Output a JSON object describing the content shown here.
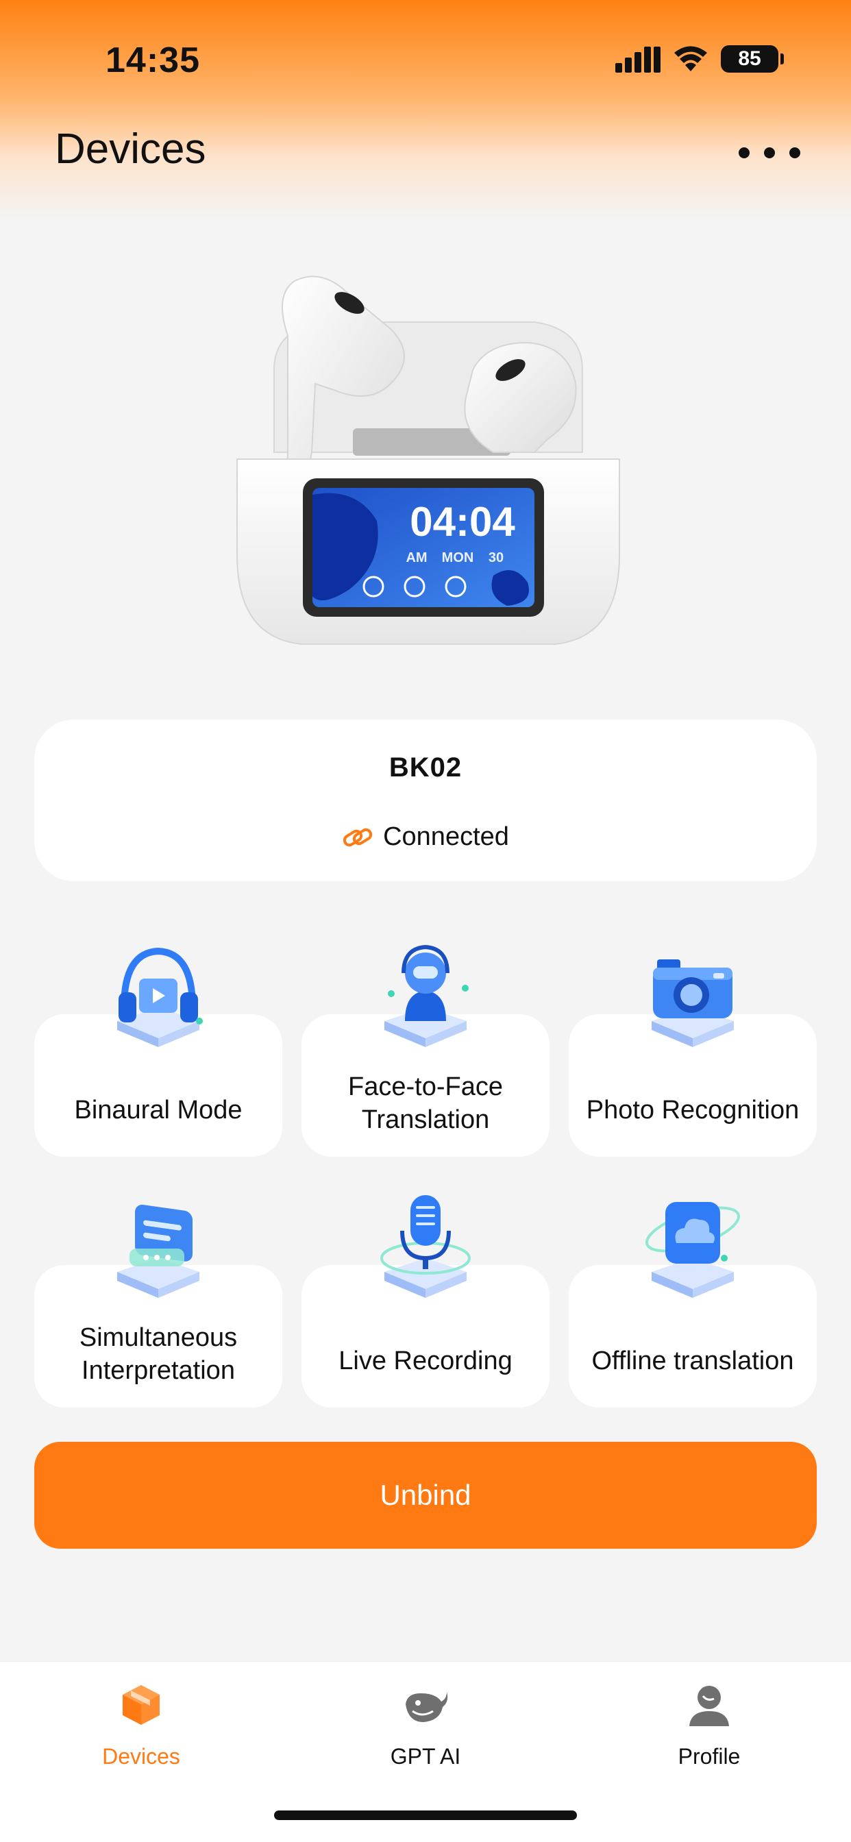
{
  "status_bar": {
    "time": "14:35",
    "battery": "85",
    "signal_icon": "cellular-signal-icon",
    "wifi_icon": "wifi-icon"
  },
  "header": {
    "title": "Devices",
    "more_icon": "more-horizontal-icon"
  },
  "product": {
    "display": {
      "time": "04:04",
      "ampm": "AM",
      "day": "MON",
      "date": "30"
    }
  },
  "device": {
    "name": "BK02",
    "status": "Connected",
    "status_icon": "link-icon"
  },
  "features": [
    {
      "label": "Binaural Mode",
      "icon": "headphones-icon"
    },
    {
      "label": "Face-to-Face\nTranslation",
      "icon": "face-to-face-icon"
    },
    {
      "label": "Photo Recognition",
      "icon": "camera-icon"
    },
    {
      "label": "Simultaneous\nInterpretation",
      "icon": "chat-bubble-icon"
    },
    {
      "label": "Live Recording",
      "icon": "microphone-icon"
    },
    {
      "label": "Offline translation",
      "icon": "cloud-icon"
    }
  ],
  "unbind_label": "Unbind",
  "tabs": [
    {
      "label": "Devices",
      "icon": "cube-icon",
      "active": true
    },
    {
      "label": "GPT AI",
      "icon": "whale-icon",
      "active": false
    },
    {
      "label": "Profile",
      "icon": "person-icon",
      "active": false
    }
  ],
  "colors": {
    "accent": "#ff7a12",
    "background": "#f4f4f4",
    "card": "#ffffff",
    "feature_blue": "#2f7cf6"
  }
}
